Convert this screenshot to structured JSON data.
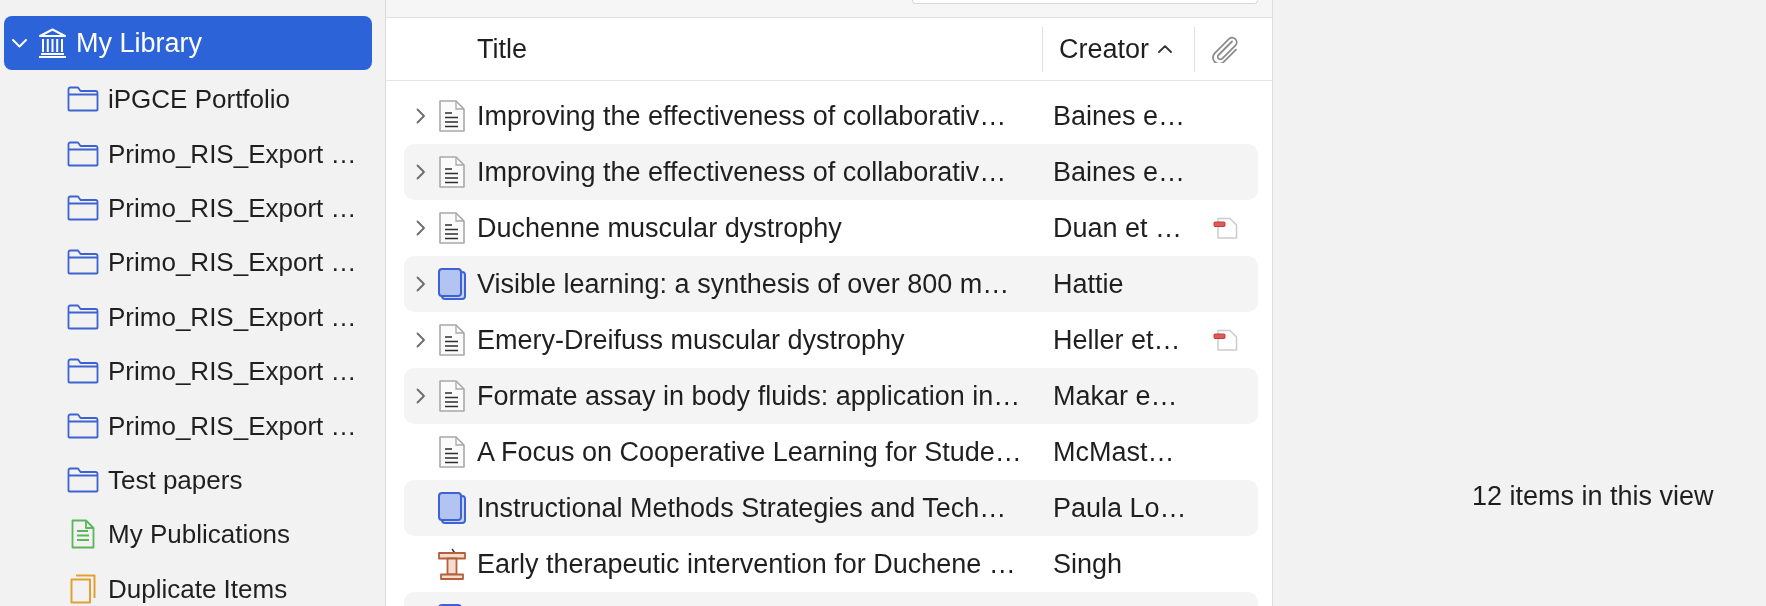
{
  "sidebar": {
    "library": {
      "label": "My Library",
      "expanded": true,
      "selected": true
    },
    "items": [
      {
        "kind": "collection",
        "label": "iPGCE Portfolio",
        "selected": false
      },
      {
        "kind": "collection",
        "label": "Primo_RIS_Export …",
        "selected": false
      },
      {
        "kind": "collection",
        "label": "Primo_RIS_Export …",
        "selected": false
      },
      {
        "kind": "collection",
        "label": "Primo_RIS_Export …",
        "selected": false
      },
      {
        "kind": "collection",
        "label": "Primo_RIS_Export …",
        "selected": false
      },
      {
        "kind": "collection",
        "label": "Primo_RIS_Export …",
        "selected": false
      },
      {
        "kind": "collection",
        "label": "Primo_RIS_Export …",
        "selected": false
      },
      {
        "kind": "collection",
        "label": "Test papers",
        "selected": false
      },
      {
        "kind": "publications",
        "label": "My Publications",
        "selected": false
      },
      {
        "kind": "duplicates",
        "label": "Duplicate Items",
        "selected": false
      }
    ]
  },
  "items_table": {
    "columns": [
      {
        "kind": "title",
        "label": "Title",
        "sorted": false
      },
      {
        "kind": "creator",
        "label": "Creator",
        "sorted": true
      },
      {
        "kind": "attachments",
        "sorted": false
      }
    ],
    "rows": [
      {
        "kind": "document",
        "expandable": true,
        "title": "Improving the effectiveness of collaborativ…",
        "creator": "Baines e…",
        "has_pdf": false,
        "selected": false
      },
      {
        "kind": "document",
        "expandable": true,
        "title": "Improving the effectiveness of collaborativ…",
        "creator": "Baines e…",
        "has_pdf": false,
        "selected": false
      },
      {
        "kind": "document",
        "expandable": true,
        "title": "Duchenne muscular dystrophy",
        "creator": "Duan et …",
        "has_pdf": true,
        "selected": false
      },
      {
        "kind": "book",
        "expandable": true,
        "title": "Visible learning: a synthesis of over 800 m…",
        "creator": "Hattie",
        "has_pdf": false,
        "selected": false
      },
      {
        "kind": "document",
        "expandable": true,
        "title": "Emery-Dreifuss muscular dystrophy",
        "creator": "Heller et…",
        "has_pdf": true,
        "selected": false
      },
      {
        "kind": "document",
        "expandable": true,
        "title": "Formate assay in body fluids: application in…",
        "creator": "Makar e…",
        "has_pdf": false,
        "selected": false
      },
      {
        "kind": "document",
        "expandable": false,
        "title": "A Focus on Cooperative Learning for Stude…",
        "creator": "McMast…",
        "has_pdf": false,
        "selected": false
      },
      {
        "kind": "book",
        "expandable": false,
        "title": "Instructional Methods Strategies and Tech…",
        "creator": "Paula Lo…",
        "has_pdf": false,
        "selected": false
      },
      {
        "kind": "presentation",
        "expandable": false,
        "title": "Early therapeutic intervention for Duchene …",
        "creator": "Singh",
        "has_pdf": false,
        "selected": false
      },
      {
        "kind": "book",
        "expandable": false,
        "has_pdf": false,
        "selected": false
      }
    ]
  },
  "status": {
    "text": "12 items in this view"
  }
}
